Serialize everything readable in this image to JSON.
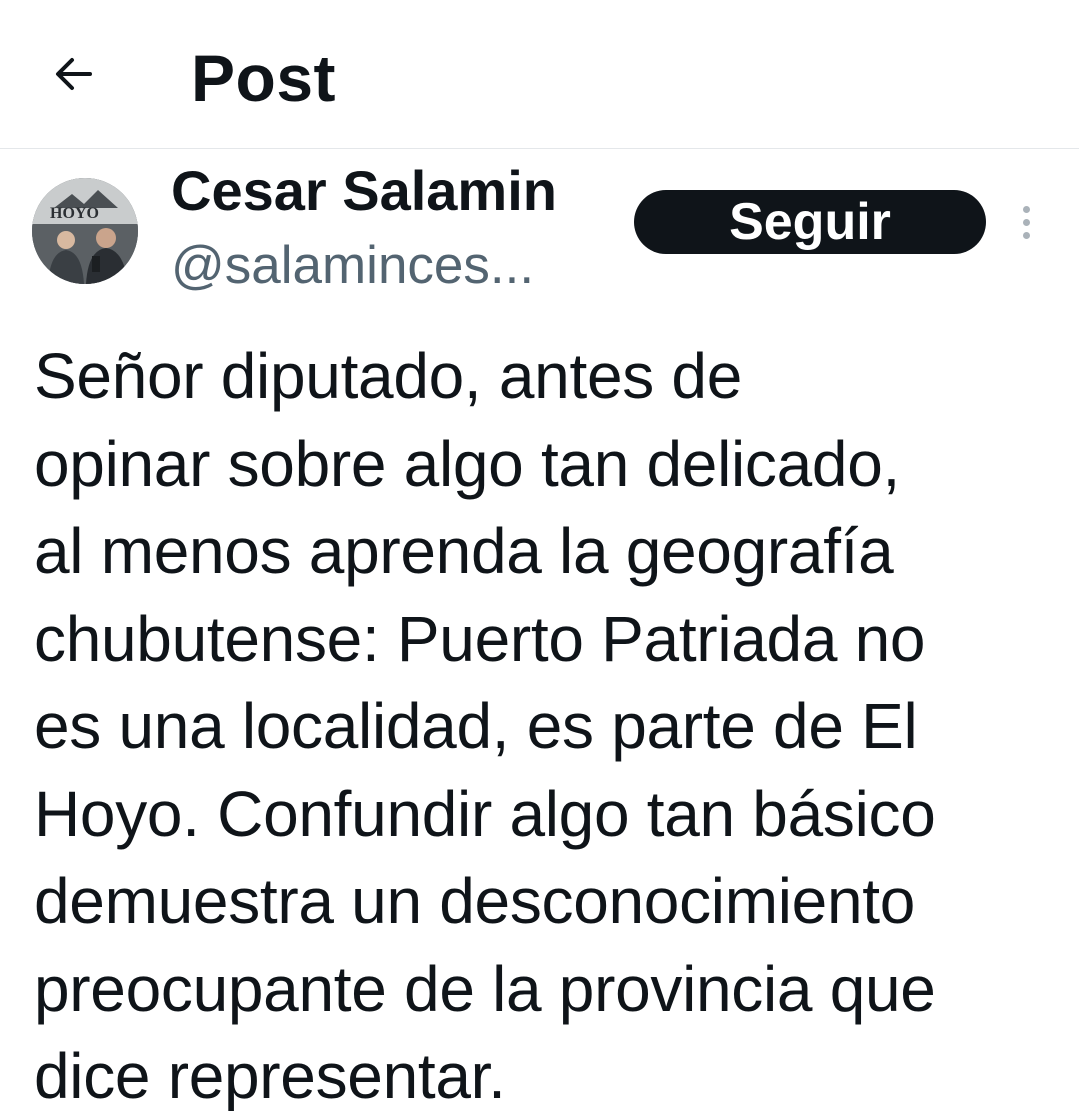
{
  "header": {
    "back_icon": "arrow-left-icon",
    "title": "Post"
  },
  "author": {
    "name": "Cesar Salamin",
    "handle": "@salaminces...",
    "avatar_logo_text": "HOYO"
  },
  "actions": {
    "follow_label": "Seguir",
    "more_icon": "more-vertical-icon"
  },
  "post": {
    "text": "Señor diputado, antes de\nopinar sobre algo tan delicado,\nal menos aprenda la geografía\nchubutense: Puerto Patriada no\nes una localidad, es parte de El\nHoyo. Confundir algo tan básico\ndemuestra un desconocimiento\npreocupante de la provincia que\ndice representar."
  },
  "colors": {
    "text": "#0f1419",
    "secondary": "#536471",
    "button_bg": "#0f1419",
    "divider": "#e4e7ea"
  }
}
